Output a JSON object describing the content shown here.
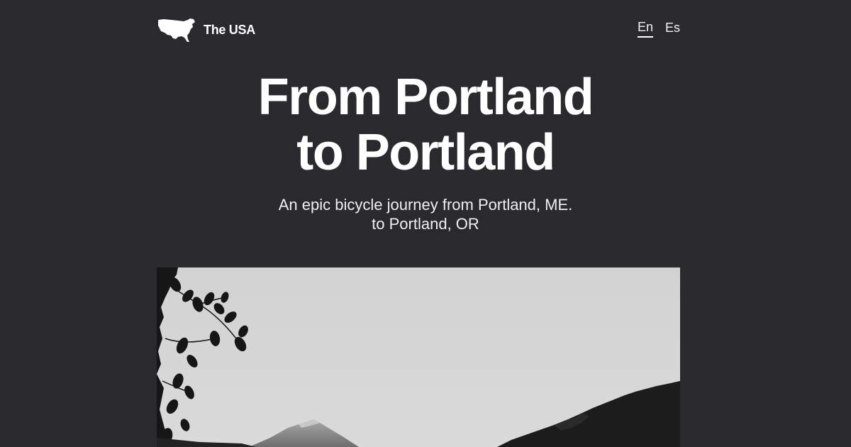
{
  "header": {
    "brand_name": "The USA",
    "logo_icon": "usa-map-icon",
    "languages": [
      {
        "label": "En",
        "active": true
      },
      {
        "label": "Es",
        "active": false
      }
    ]
  },
  "hero_text": {
    "title_line1": "From Portland",
    "title_line2": "to Portland",
    "subtitle_line1": "An epic bicycle journey from Portland, ME.",
    "subtitle_line2": "to Portland, OR"
  },
  "hero_image": {
    "icon": "mountain-landscape-photo",
    "colors": {
      "sky": "#d4d4d4",
      "foliage": "#1a1a1a",
      "mountain": "#8a8a8a"
    }
  }
}
